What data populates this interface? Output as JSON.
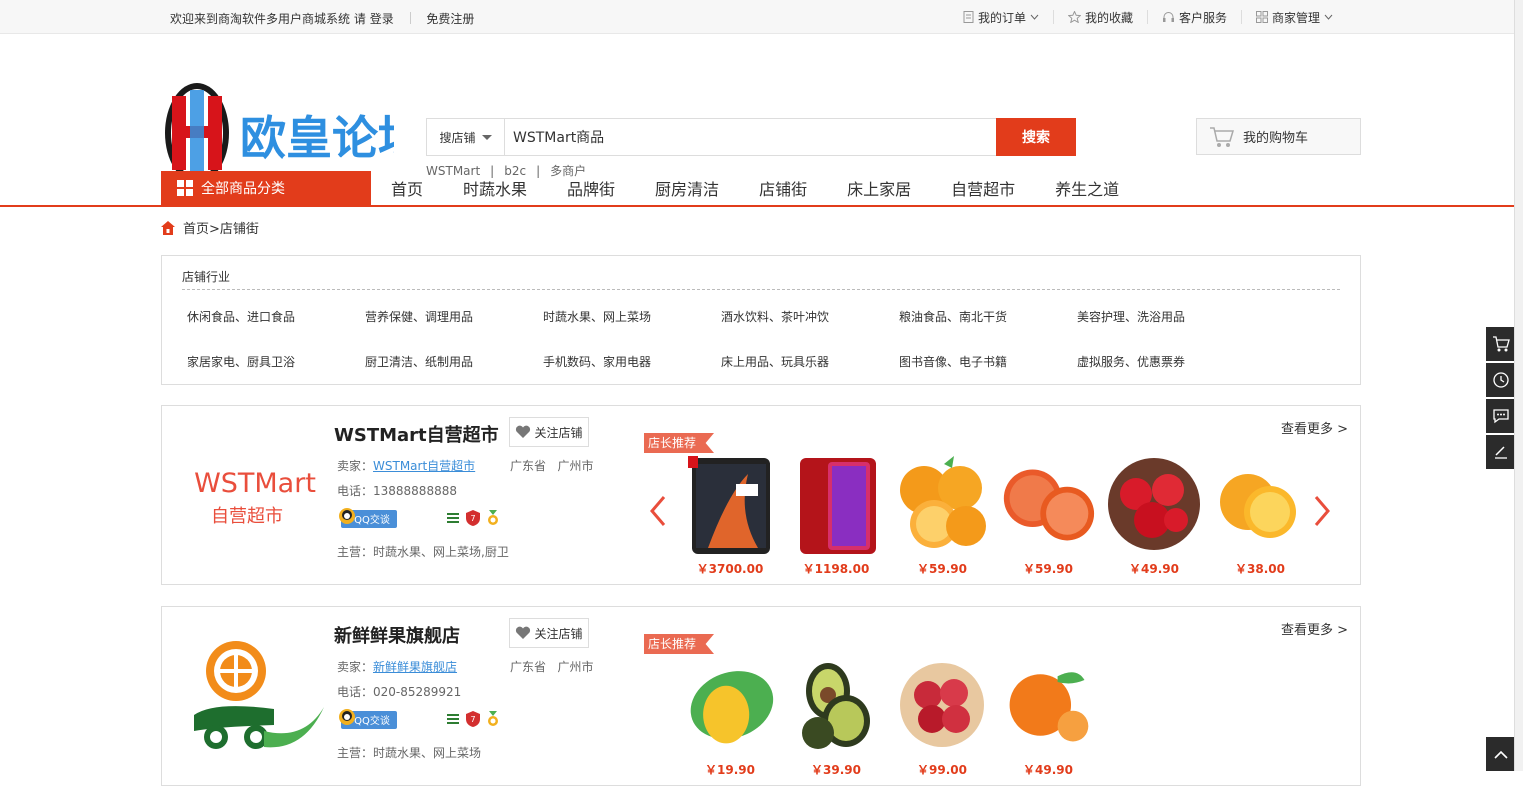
{
  "topbar": {
    "welcome": "欢迎来到商淘软件多用户商城系统",
    "please": "请",
    "login": "登录",
    "register": "免费注册",
    "my_orders": "我的订单",
    "my_favorites": "我的收藏",
    "customer_service": "客户服务",
    "merchant_admin": "商家管理"
  },
  "logo": {
    "text": "欧皇论坛",
    "mark": "H"
  },
  "search": {
    "type_label": "搜店铺",
    "value": "WSTMart商品",
    "button": "搜索",
    "hotwords": [
      "WSTMart",
      "b2c",
      "多商户"
    ]
  },
  "cart": {
    "label": "我的购物车"
  },
  "nav": {
    "all_categories": "全部商品分类",
    "items": [
      "首页",
      "时蔬水果",
      "品牌街",
      "厨房清洁",
      "店铺街",
      "床上家居",
      "自营超市",
      "养生之道"
    ]
  },
  "breadcrumb": {
    "home": "首页",
    "sep": ">",
    "current": "店铺街"
  },
  "industry": {
    "title": "店铺行业",
    "items": [
      "休闲食品、进口食品",
      "营养保健、调理用品",
      "时蔬水果、网上菜场",
      "酒水饮料、茶叶冲饮",
      "粮油食品、南北干货",
      "美容护理、洗浴用品",
      "家居家电、厨具卫浴",
      "厨卫清洁、纸制用品",
      "手机数码、家用电器",
      "床上用品、玩具乐器",
      "图书音像、电子书籍",
      "虚拟服务、优惠票券"
    ]
  },
  "shops": [
    {
      "name": "WSTMart自营超市",
      "follow": "关注店铺",
      "seller_label": "卖家：",
      "seller": "WSTMart自营超市",
      "province": "广东省",
      "city": "广州市",
      "phone": "电话：13888888888",
      "qq": "QQ交谈",
      "main": "主营：时蔬水果、网上菜场,厨卫",
      "more": "查看更多 >",
      "rec": "店长推荐",
      "logo_top": "WSTMart",
      "logo_bottom": "自营超市",
      "products": [
        "￥3700.00",
        "￥1198.00",
        "￥59.90",
        "￥59.90",
        "￥49.90",
        "￥38.00"
      ]
    },
    {
      "name": "新鲜鲜果旗舰店",
      "follow": "关注店铺",
      "seller_label": "卖家：",
      "seller": "新鲜鲜果旗舰店",
      "province": "广东省",
      "city": "广州市",
      "phone": "电话：020-85289921",
      "qq": "QQ交谈",
      "main": "主营：时蔬水果、网上菜场",
      "more": "查看更多 >",
      "rec": "店长推荐",
      "products": [
        "￥19.90",
        "￥39.90",
        "￥99.00",
        "￥49.90"
      ]
    }
  ],
  "colors": {
    "accent": "#e23c1b",
    "link": "#3b8dd8",
    "logo_blue": "#2e8fe0"
  }
}
